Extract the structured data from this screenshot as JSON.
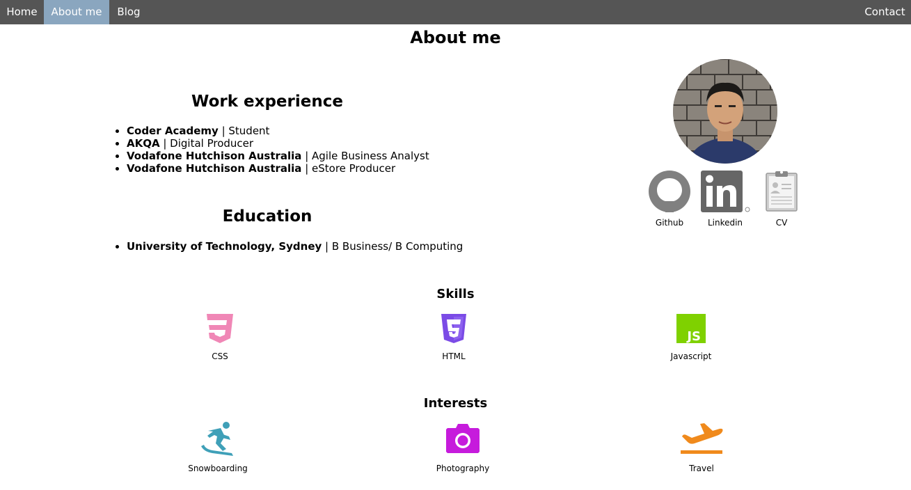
{
  "nav": {
    "home": "Home",
    "about": "About me",
    "blog": "Blog",
    "contact": "Contact"
  },
  "page_title": "About me",
  "work": {
    "title": "Work experience",
    "items": [
      {
        "org": "Coder Academy",
        "role": " | Student"
      },
      {
        "org": "AKQA",
        "role": " | Digital Producer"
      },
      {
        "org": "Vodafone Hutchison Australia",
        "role": " | Agile Business Analyst"
      },
      {
        "org": "Vodafone Hutchison Australia",
        "role": " | eStore Producer"
      }
    ]
  },
  "education": {
    "title": "Education",
    "items": [
      {
        "org": "University of Technology, Sydney",
        "role": " | B Business/ B Computing"
      }
    ]
  },
  "profile": {
    "links": [
      {
        "label": "Github",
        "icon": "github-icon"
      },
      {
        "label": "Linkedin",
        "icon": "linkedin-icon"
      },
      {
        "label": "CV",
        "icon": "clipboard-icon"
      }
    ]
  },
  "skills": {
    "title": "Skills",
    "items": [
      {
        "label": "CSS",
        "icon": "css3-icon",
        "color": "#f087b6"
      },
      {
        "label": "HTML",
        "icon": "html5-icon",
        "color": "#7b4be6"
      },
      {
        "label": "Javascript",
        "icon": "javascript-icon",
        "color": "#7fd100"
      }
    ]
  },
  "interests": {
    "title": "Interests",
    "items": [
      {
        "label": "Snowboarding",
        "icon": "snowboarder-icon",
        "color": "#3fa0b8"
      },
      {
        "label": "Photography",
        "icon": "camera-icon",
        "color": "#c61bdc"
      },
      {
        "label": "Travel",
        "icon": "airplane-icon",
        "color": "#f08a1c"
      }
    ]
  }
}
